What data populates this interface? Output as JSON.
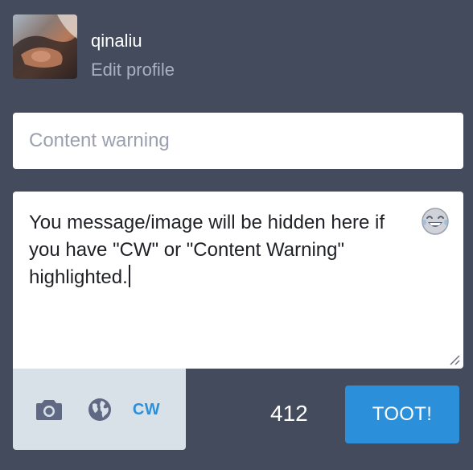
{
  "profile": {
    "display_name": "qinaliu",
    "edit_profile_label": "Edit profile"
  },
  "compose": {
    "cw_placeholder": "Content warning",
    "cw_value": "",
    "text": "You message/image will be hidden here if you have \"CW\" or \"Content Warning\" highlighted.",
    "emoji_icon": "laughing-tears-emoji-icon"
  },
  "toolbar": {
    "camera_icon": "camera-icon",
    "privacy_icon": "globe-icon",
    "cw_label": "CW",
    "char_count": "412",
    "submit_label": "TOOT!"
  },
  "colors": {
    "background": "#444b5d",
    "accent": "#2b90d9",
    "toolbar_bg": "#d9e1e8",
    "muted_text": "#a9b0c2"
  }
}
